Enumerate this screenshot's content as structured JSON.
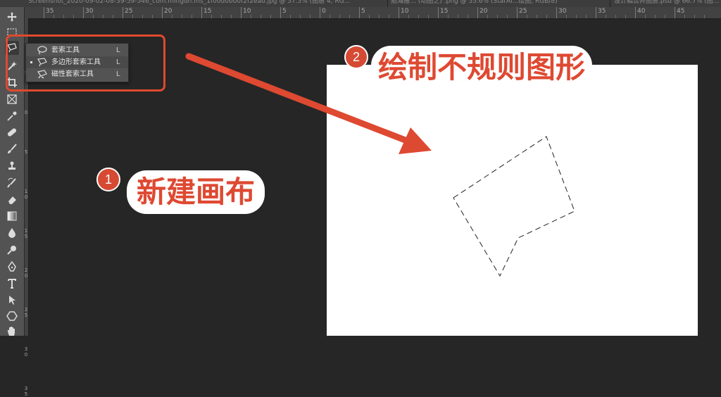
{
  "tabs": [
    {
      "label": "Screenshot_2020-09-02-08-39-59-546_com.mingdn.ms_1f00d0b00f2f2eab.jpg @ 57.5% (图层 4, RG..."
    },
    {
      "label": "贴海报… (动图之) .png @ 55.6% (StarAI...绘图, RGB/8)"
    },
    {
      "label": "设计稿合并图层.psd @ 66.7% (图..."
    }
  ],
  "ruler": {
    "top_labels": [
      "35",
      "30",
      "25",
      "20",
      "15",
      "10",
      "5",
      "0",
      "5",
      "10",
      "15",
      "20",
      "25",
      "30",
      "35",
      "40",
      "45"
    ],
    "left_labels": [
      "5",
      "0",
      "5",
      "1\n0",
      "1\n5",
      "2\n0",
      "2\n5",
      "3\n0",
      "3\n5"
    ]
  },
  "toolbar": {
    "tools": [
      {
        "name": "move-tool-icon"
      },
      {
        "name": "marquee-tool-icon"
      },
      {
        "name": "lasso-tool-icon"
      },
      {
        "name": "magic-wand-tool-icon"
      },
      {
        "name": "crop-tool-icon"
      },
      {
        "name": "frame-tool-icon"
      },
      {
        "name": "eyedropper-tool-icon"
      },
      {
        "name": "healing-brush-tool-icon"
      },
      {
        "name": "brush-tool-icon"
      },
      {
        "name": "clone-stamp-tool-icon"
      },
      {
        "name": "history-brush-tool-icon"
      },
      {
        "name": "eraser-tool-icon"
      },
      {
        "name": "gradient-tool-icon"
      },
      {
        "name": "blur-tool-icon"
      },
      {
        "name": "dodge-tool-icon"
      },
      {
        "name": "pen-tool-icon"
      },
      {
        "name": "type-tool-icon"
      },
      {
        "name": "path-selection-tool-icon"
      },
      {
        "name": "shape-tool-icon"
      },
      {
        "name": "hand-tool-icon"
      }
    ]
  },
  "flyout": {
    "items": [
      {
        "label": "套索工具",
        "shortcut": "L",
        "selected": false
      },
      {
        "label": "多边形套索工具",
        "shortcut": "L",
        "selected": true
      },
      {
        "label": "磁性套索工具",
        "shortcut": "L",
        "selected": false
      }
    ]
  },
  "annotations": {
    "step1": {
      "number": "1",
      "text": "新建画布"
    },
    "step2": {
      "number": "2",
      "text": "绘制不规则图形"
    }
  },
  "colors": {
    "accent": "#de4932",
    "badge": "#d64a33",
    "workspace": "#262626",
    "panel": "#535353",
    "canvas": "#ffffff"
  }
}
